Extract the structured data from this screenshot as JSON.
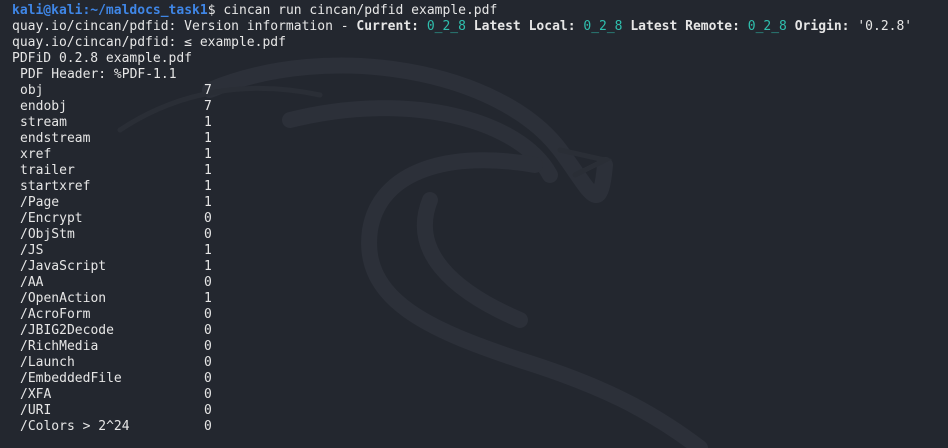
{
  "prompt": {
    "user_host": "kali@kali",
    "sep": ":",
    "path": "~/maldocs_task1",
    "symbol": "$",
    "command": " cincan run cincan/pdfid example.pdf"
  },
  "version_line": {
    "prefix": "quay.io/cincan/pdfid: Version information - ",
    "current_label": "Current:",
    "current_value": "0_2_8",
    "latest_local_label": "Latest Local:",
    "latest_local_value": "0_2_8",
    "latest_remote_label": "Latest Remote:",
    "latest_remote_value": "0_2_8",
    "origin_label": "Origin:",
    "origin_value": "'0.2.8'"
  },
  "file_line": "quay.io/cincan/pdfid: ≤ example.pdf",
  "pdfid_line": "PDFiD 0.2.8 example.pdf",
  "header_line": "PDF Header: %PDF-1.1",
  "rows": [
    {
      "key": "obj",
      "value": "7"
    },
    {
      "key": "endobj",
      "value": "7"
    },
    {
      "key": "stream",
      "value": "1"
    },
    {
      "key": "endstream",
      "value": "1"
    },
    {
      "key": "xref",
      "value": "1"
    },
    {
      "key": "trailer",
      "value": "1"
    },
    {
      "key": "startxref",
      "value": "1"
    },
    {
      "key": "/Page",
      "value": "1"
    },
    {
      "key": "/Encrypt",
      "value": "0"
    },
    {
      "key": "/ObjStm",
      "value": "0"
    },
    {
      "key": "/JS",
      "value": "1"
    },
    {
      "key": "/JavaScript",
      "value": "1"
    },
    {
      "key": "/AA",
      "value": "0"
    },
    {
      "key": "/OpenAction",
      "value": "1"
    },
    {
      "key": "/AcroForm",
      "value": "0"
    },
    {
      "key": "/JBIG2Decode",
      "value": "0"
    },
    {
      "key": "/RichMedia",
      "value": "0"
    },
    {
      "key": "/Launch",
      "value": "0"
    },
    {
      "key": "/EmbeddedFile",
      "value": "0"
    },
    {
      "key": "/XFA",
      "value": "0"
    },
    {
      "key": "/URI",
      "value": "0"
    },
    {
      "key": "/Colors > 2^24",
      "value": "0"
    }
  ],
  "colors": {
    "background": "#23272f",
    "prompt": "#3f86e6",
    "version_value": "#2fbfae",
    "text": "#e6e6e6"
  },
  "icons": {
    "background_watermark": "kali-dragon-icon"
  }
}
